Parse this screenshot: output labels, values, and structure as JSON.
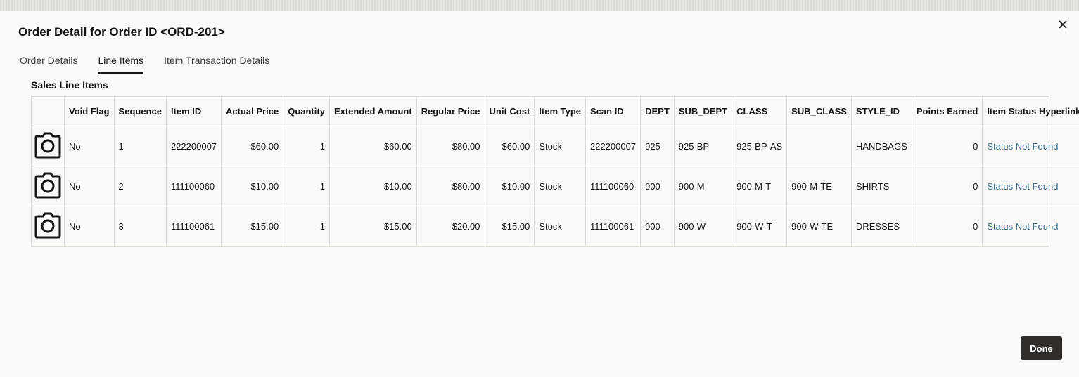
{
  "dialog": {
    "title": "Order Detail for Order ID <ORD-201>",
    "close_icon": "close-icon",
    "done_label": "Done"
  },
  "tabs": [
    {
      "label": "Order Details",
      "active": false
    },
    {
      "label": "Line Items",
      "active": true
    },
    {
      "label": "Item Transaction Details",
      "active": false
    }
  ],
  "section": {
    "title": "Sales Line Items"
  },
  "table": {
    "columns": [
      "",
      "Void Flag",
      "Sequence",
      "Item ID",
      "Actual Price",
      "Quantity",
      "Extended Amount",
      "Regular Price",
      "Unit Cost",
      "Item Type",
      "Scan ID",
      "DEPT",
      "SUB_DEPT",
      "CLASS",
      "SUB_CLASS",
      "STYLE_ID",
      "Points Earned",
      "Item Status Hyperlink"
    ],
    "image_icon": "camera-icon",
    "rows": [
      {
        "void_flag": "No",
        "sequence": "1",
        "item_id": "222200007",
        "actual_price": "$60.00",
        "quantity": "1",
        "extended_amount": "$60.00",
        "regular_price": "$80.00",
        "unit_cost": "$60.00",
        "item_type": "Stock",
        "scan_id": "222200007",
        "dept": "925",
        "sub_dept": "925-BP",
        "class": "925-BP-AS",
        "sub_class": "",
        "style_id": "HANDBAGS",
        "points_earned": "0",
        "status_link": "Status Not Found"
      },
      {
        "void_flag": "No",
        "sequence": "2",
        "item_id": "111100060",
        "actual_price": "$10.00",
        "quantity": "1",
        "extended_amount": "$10.00",
        "regular_price": "$80.00",
        "unit_cost": "$10.00",
        "item_type": "Stock",
        "scan_id": "111100060",
        "dept": "900",
        "sub_dept": "900-M",
        "class": "900-M-T",
        "sub_class": "900-M-TE",
        "style_id": "SHIRTS",
        "points_earned": "0",
        "status_link": "Status Not Found"
      },
      {
        "void_flag": "No",
        "sequence": "3",
        "item_id": "111100061",
        "actual_price": "$15.00",
        "quantity": "1",
        "extended_amount": "$15.00",
        "regular_price": "$20.00",
        "unit_cost": "$15.00",
        "item_type": "Stock",
        "scan_id": "111100061",
        "dept": "900",
        "sub_dept": "900-W",
        "class": "900-W-T",
        "sub_class": "900-W-TE",
        "style_id": "DRESSES",
        "points_earned": "0",
        "status_link": "Status Not Found"
      }
    ]
  },
  "colors": {
    "link": "#2f6a8c",
    "primary_button": "#312d2a",
    "background": "#fbf9f8"
  }
}
